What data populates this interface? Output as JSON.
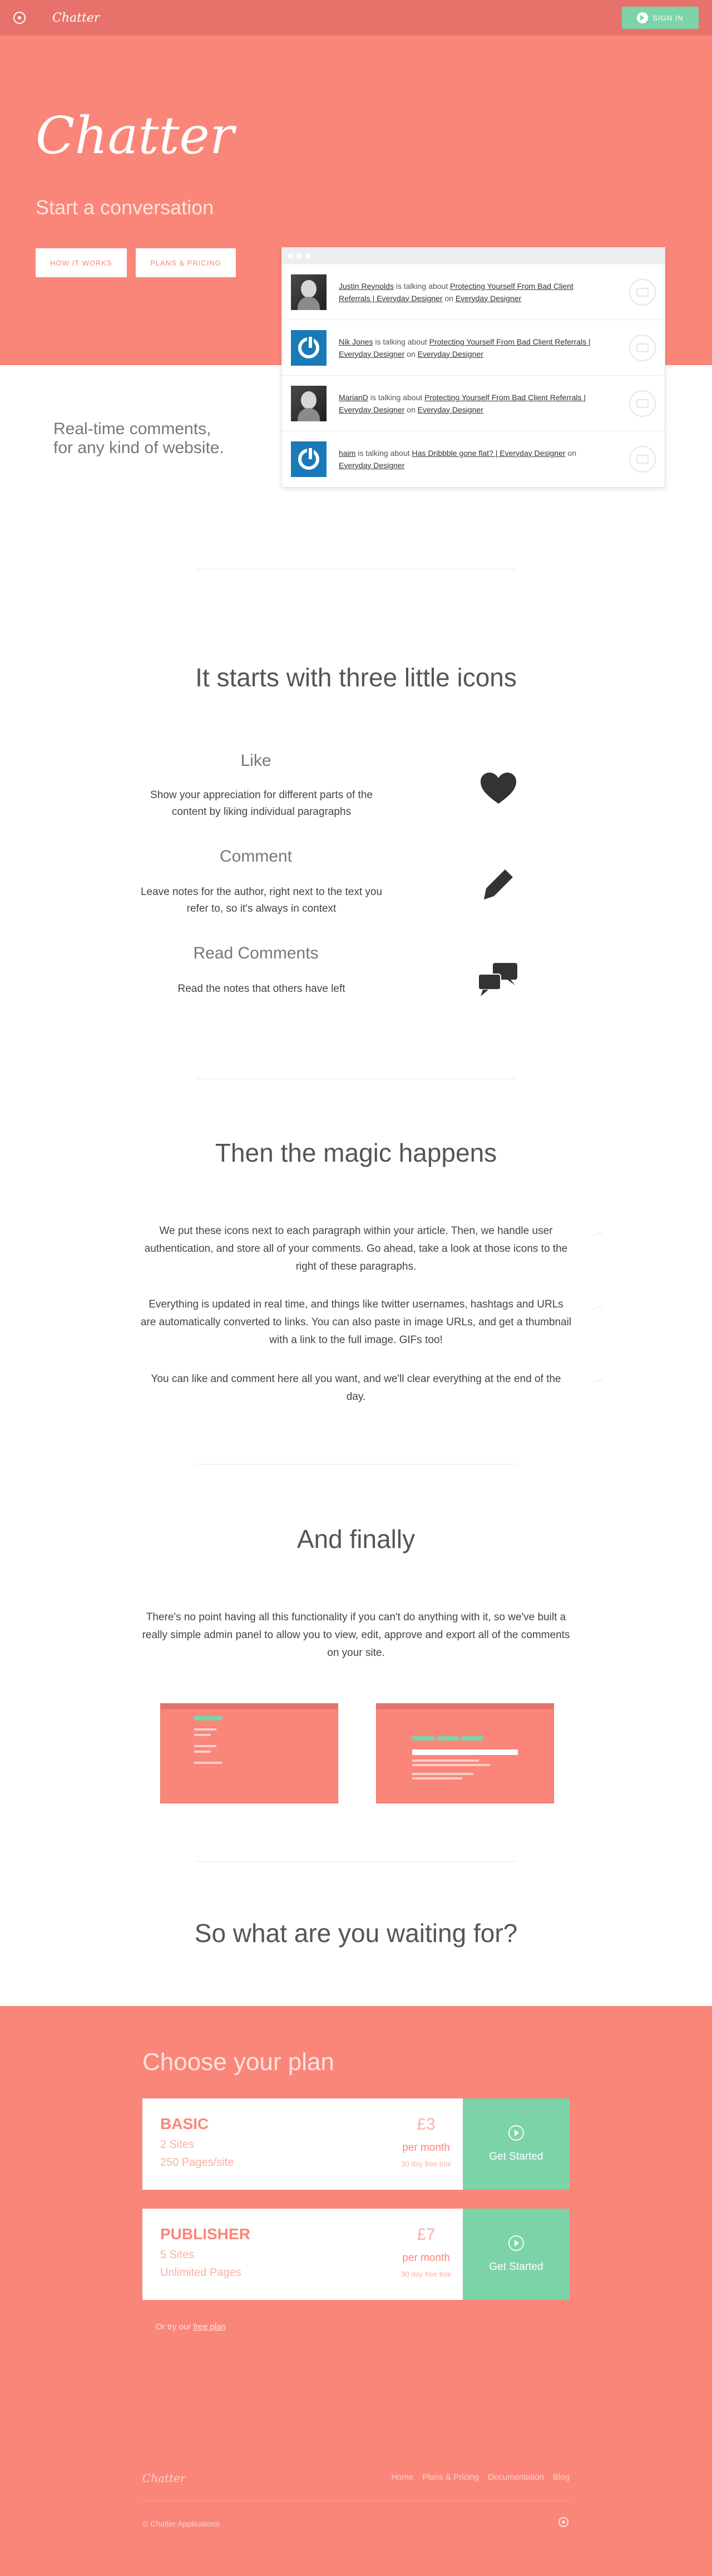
{
  "nav": {
    "brand": "Chatter",
    "signin": "SIGN IN"
  },
  "hero": {
    "title": "Chatter",
    "tagline": "Start a conversation",
    "how_button": "HOW IT WORKS",
    "plans_button": "PLANS & PRICING"
  },
  "feed": [
    {
      "user": "Justin Reynolds",
      "verb": " is talking about ",
      "article": "Protecting Yourself From Bad Client Referrals | Everyday Designer",
      "on": " on ",
      "site": "Everyday Designer",
      "avatar": "photo"
    },
    {
      "user": "Nik Jones",
      "verb": " is talking about ",
      "article": "Protecting Yourself From Bad Client Referrals | Everyday Designer",
      "on": " on ",
      "site": "Everyday Designer",
      "avatar": "power"
    },
    {
      "user": "MarianD",
      "verb": " is talking about ",
      "article": "Protecting Yourself From Bad Client Referrals | Everyday Designer",
      "on": " on ",
      "site": "Everyday Designer",
      "avatar": "photo"
    },
    {
      "user": "haim",
      "verb": " is talking about ",
      "article": "Has Dribbble gone flat? | Everyday Designer",
      "on": " on ",
      "site": "Everyday Designer",
      "avatar": "power"
    }
  ],
  "realtime": {
    "line1": "Real-time comments,",
    "line2": "for any kind of website."
  },
  "icons_section": {
    "heading": "It starts with three little icons",
    "features": [
      {
        "title": "Like",
        "desc": "Show your appreciation for different parts of the content by liking individual paragraphs",
        "icon": "heart-icon"
      },
      {
        "title": "Comment",
        "desc": "Leave notes for the author, right next to the text you refer to, so it's always in context",
        "icon": "pencil-icon"
      },
      {
        "title": "Read Comments",
        "desc": "Read the notes that others have left",
        "icon": "chat-bubbles-icon"
      }
    ]
  },
  "magic": {
    "heading": "Then the magic happens",
    "paragraphs": [
      "We put these icons next to each paragraph within your article. Then, we handle user authentication, and store all of your comments. Go ahead, take a look at those icons to the right of these paragraphs.",
      "Everything is updated in real time, and things like twitter usernames, hashtags and URLs are automatically converted to links. You can also paste in image URLs, and get a thumbnail with a link to the full image. GIFs too!",
      "You can like and comment here all you want, and we'll clear everything at the end of the day."
    ]
  },
  "finally": {
    "heading": "And finally",
    "paragraph": "There's no point having all this functionality if you can't do anything with it, so we've built a really simple admin panel to allow you to view, edit, approve and export all of the comments on your site."
  },
  "waiting": {
    "heading": "So what are you waiting for?"
  },
  "pricing": {
    "heading": "Choose your plan",
    "plans": [
      {
        "name": "BASIC",
        "sites": "2 Sites",
        "pages": "250 Pages/site",
        "price": "£3",
        "per": "per month",
        "trial": "30 day free trial",
        "cta": "Get Started"
      },
      {
        "name": "PUBLISHER",
        "sites": "5 Sites",
        "pages": "Unlimited Pages",
        "price": "£7",
        "per": "per month",
        "trial": "30 day free trial",
        "cta": "Get Started"
      }
    ],
    "free_prefix": "Or try our ",
    "free_link": "free plan"
  },
  "footer": {
    "logo": "Chatter",
    "links": [
      "Home",
      "Plans & Pricing",
      "Documentation",
      "Blog"
    ],
    "copyright": "© Chatter Applications"
  },
  "colors": {
    "coral": "#fa8679",
    "nav": "#e6726b",
    "mint": "#7dd3a8"
  }
}
